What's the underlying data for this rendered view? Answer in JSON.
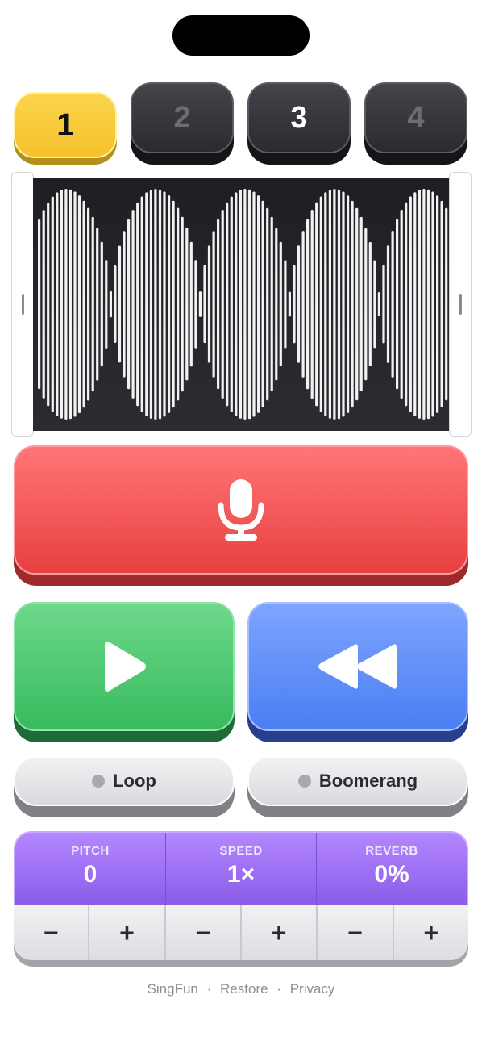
{
  "slots": [
    {
      "label": "1",
      "state": "selected"
    },
    {
      "label": "2",
      "state": "empty"
    },
    {
      "label": "3",
      "state": "filled"
    },
    {
      "label": "4",
      "state": "empty"
    }
  ],
  "controls": {
    "record_icon": "microphone-icon",
    "play_icon": "play-icon",
    "rewind_icon": "rewind-icon"
  },
  "toggles": {
    "loop": {
      "label": "Loop",
      "on": false
    },
    "boomerang": {
      "label": "Boomerang",
      "on": false
    }
  },
  "effects": [
    {
      "label": "PITCH",
      "value": "0",
      "minus": "−",
      "plus": "+"
    },
    {
      "label": "SPEED",
      "value": "1×",
      "minus": "−",
      "plus": "+"
    },
    {
      "label": "REVERB",
      "value": "0%",
      "minus": "−",
      "plus": "+"
    }
  ],
  "footer": {
    "app": "SingFun",
    "restore": "Restore",
    "privacy": "Privacy",
    "separator": "·"
  },
  "colors": {
    "slot_selected": "#f6c12d",
    "record": "#e8403f",
    "play": "#38bb5e",
    "rewind": "#4a7ef3",
    "effects": "#8a5ce8"
  }
}
